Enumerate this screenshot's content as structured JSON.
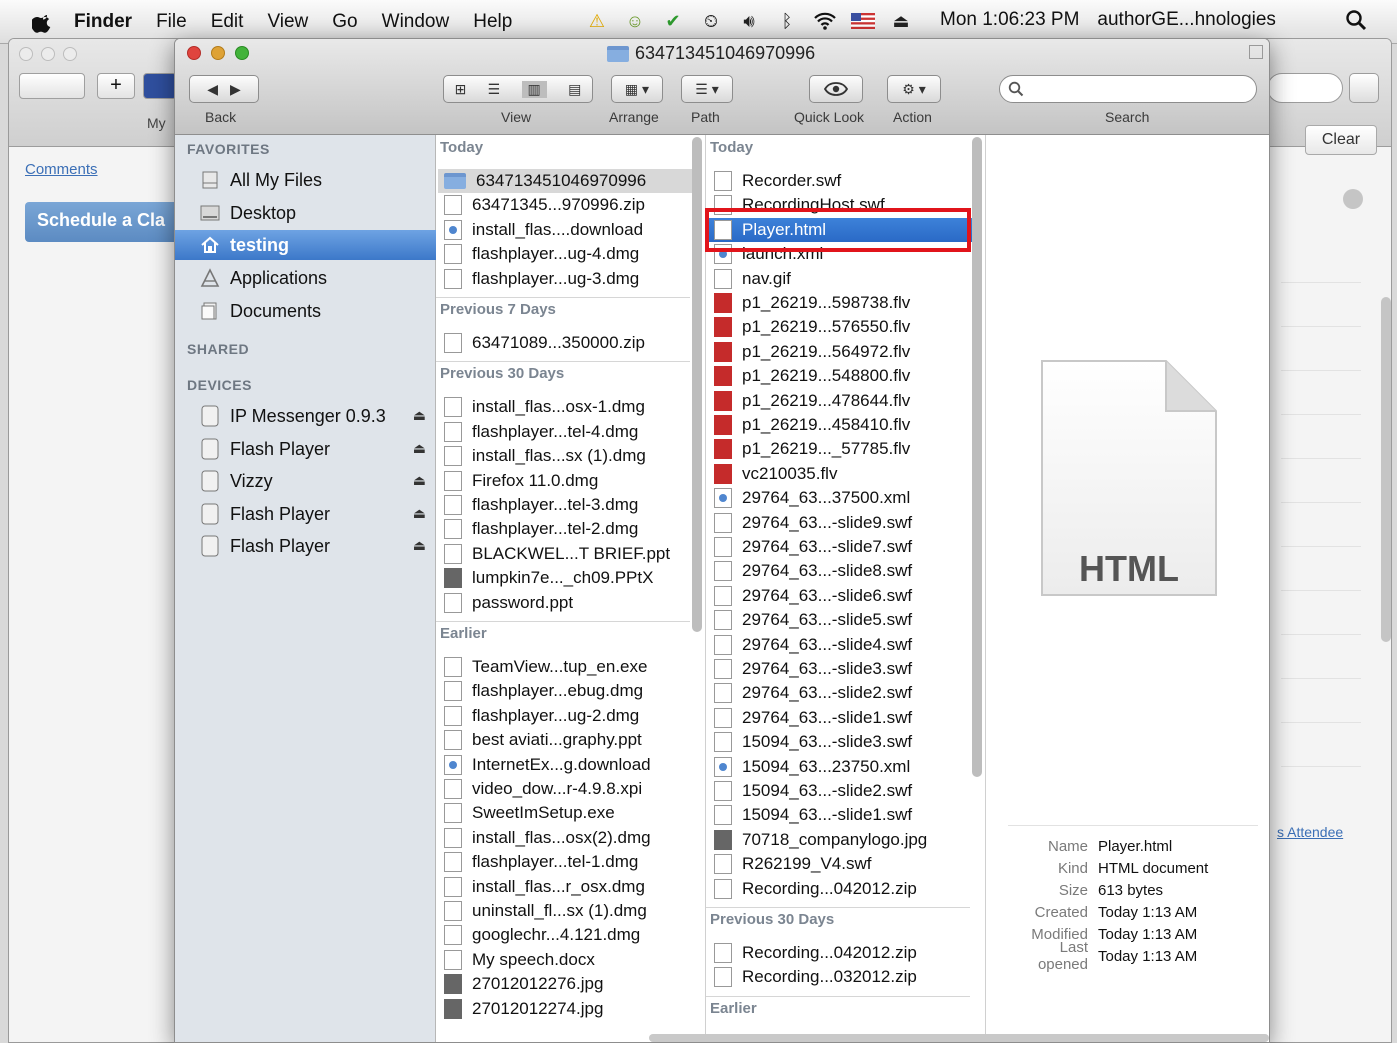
{
  "menubar": {
    "app": "Finder",
    "menus": [
      "File",
      "Edit",
      "View",
      "Go",
      "Window",
      "Help"
    ],
    "clock": "Mon 1:06:23 PM",
    "user": "authorGE...hnologies"
  },
  "background_window": {
    "tab_label": "My",
    "comments_link": "Comments",
    "schedule_button": "Schedule a Cla",
    "clear_button": "Clear",
    "attendee_link": "s Attendee"
  },
  "finder": {
    "title": "634713451046970996",
    "toolbar": {
      "back": "Back",
      "view": "View",
      "arrange": "Arrange",
      "path": "Path",
      "quick_look": "Quick Look",
      "action": "Action",
      "search": "Search"
    },
    "sidebar": {
      "favorites_header": "FAVORITES",
      "favorites": [
        "All My Files",
        "Desktop",
        "testing",
        "Applications",
        "Documents"
      ],
      "shared_header": "SHARED",
      "devices_header": "DEVICES",
      "devices": [
        "IP Messenger 0.9.3",
        "Flash Player",
        "Vizzy",
        "Flash Player",
        "Flash Player"
      ]
    },
    "column1": {
      "groups": [
        {
          "title": "Today",
          "items": [
            "634713451046970996",
            "63471345...970996.zip",
            "install_flas....download",
            "flashplayer...ug-4.dmg",
            "flashplayer...ug-3.dmg"
          ]
        },
        {
          "title": "Previous 7 Days",
          "items": [
            "63471089...350000.zip"
          ]
        },
        {
          "title": "Previous 30 Days",
          "items": [
            "install_flas...osx-1.dmg",
            "flashplayer...tel-4.dmg",
            "install_flas...sx (1).dmg",
            "Firefox 11.0.dmg",
            "flashplayer...tel-3.dmg",
            "flashplayer...tel-2.dmg",
            "BLACKWEL...T BRIEF.ppt",
            "lumpkin7e..._ch09.PPtX",
            "password.ppt"
          ]
        },
        {
          "title": "Earlier",
          "items": [
            "TeamView...tup_en.exe",
            "flashplayer...ebug.dmg",
            "flashplayer...ug-2.dmg",
            "best aviati...graphy.ppt",
            "InternetEx...g.download",
            "video_dow...r-4.9.8.xpi",
            "SweetImSetup.exe",
            "install_flas...osx(2).dmg",
            "flashplayer...tel-1.dmg",
            "install_flas...r_osx.dmg",
            "uninstall_fl...sx (1).dmg",
            "googlechr...4.121.dmg",
            "My speech.docx",
            "27012012276.jpg",
            "27012012274.jpg"
          ]
        }
      ]
    },
    "column2": {
      "groups": [
        {
          "title": "Today",
          "items": [
            "Recorder.swf",
            "RecordingHost.swf",
            "Player.html",
            "launch.xml",
            "nav.gif",
            "p1_26219...598738.flv",
            "p1_26219...576550.flv",
            "p1_26219...564972.flv",
            "p1_26219...548800.flv",
            "p1_26219...478644.flv",
            "p1_26219...458410.flv",
            "p1_26219..._57785.flv",
            "vc210035.flv",
            "29764_63...37500.xml",
            "29764_63...-slide9.swf",
            "29764_63...-slide7.swf",
            "29764_63...-slide8.swf",
            "29764_63...-slide6.swf",
            "29764_63...-slide5.swf",
            "29764_63...-slide4.swf",
            "29764_63...-slide3.swf",
            "29764_63...-slide2.swf",
            "29764_63...-slide1.swf",
            "15094_63...-slide3.swf",
            "15094_63...23750.xml",
            "15094_63...-slide2.swf",
            "15094_63...-slide1.swf",
            "70718_companylogo.jpg",
            "R262199_V4.swf",
            "Recording...042012.zip"
          ]
        },
        {
          "title": "Previous 30 Days",
          "items": [
            "Recording...042012.zip",
            "Recording...032012.zip"
          ]
        },
        {
          "title": "Earlier",
          "items": []
        }
      ]
    },
    "preview": {
      "icon_label": "HTML",
      "meta": [
        {
          "k": "Name",
          "v": "Player.html"
        },
        {
          "k": "Kind",
          "v": "HTML document"
        },
        {
          "k": "Size",
          "v": "613 bytes"
        },
        {
          "k": "Created",
          "v": "Today 1:13 AM"
        },
        {
          "k": "Modified",
          "v": "Today 1:13 AM"
        },
        {
          "k": "Last opened",
          "v": "Today 1:13 AM"
        }
      ]
    }
  },
  "colors": {
    "selection_blue": "#3d82d9",
    "highlight_box": "#e1141b",
    "sidebar_bg": "#dfe4ea"
  }
}
